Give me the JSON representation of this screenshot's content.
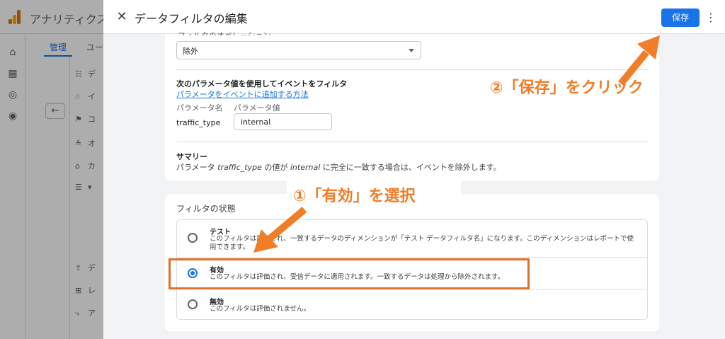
{
  "background": {
    "app_title": "アナリティクス",
    "tab_admin": "管理",
    "tab_user": "ユー",
    "nav_items": [
      "デ",
      "イ",
      "コ",
      "オ",
      "カ",
      "▾",
      "デ",
      "レ",
      "ア"
    ]
  },
  "panel": {
    "title": "データフィルタの編集",
    "save_label": "保存",
    "more_icon": "more-vert-icon",
    "operation_label": "フィルタのオペレーション",
    "operation_value": "除外",
    "param_section_title": "次のパラメータ値を使用してイベントをフィルタ",
    "param_link": "パラメータをイベントに追加する方法",
    "col_param_name": "パラメータ名",
    "col_param_value": "パラメータ値",
    "param_name": "traffic_type",
    "param_value": "internal",
    "summary_title": "サマリー",
    "summary_prefix": "パラメータ ",
    "summary_param": "traffic_type",
    "summary_mid": " の値が ",
    "summary_value": "internal",
    "summary_suffix": " に完全に一致する場合は、イベントを除外します。",
    "state_title": "フィルタの状態",
    "options": [
      {
        "title": "テスト",
        "desc": "このフィルタは評価され、一致するデータのディメンションが「テスト データフィルタ名」になります。このディメンションはレポートで使用できます。",
        "selected": false
      },
      {
        "title": "有効",
        "desc": "このフィルタは評価され、受信データに適用されます。一致するデータは処理から除外されます。",
        "selected": true
      },
      {
        "title": "無効",
        "desc": "このフィルタは評価されません。",
        "selected": false
      }
    ]
  },
  "annotations": {
    "step1": "①「有効」を選択",
    "step2": "②「保存」をクリック",
    "color": "#f07d27"
  }
}
